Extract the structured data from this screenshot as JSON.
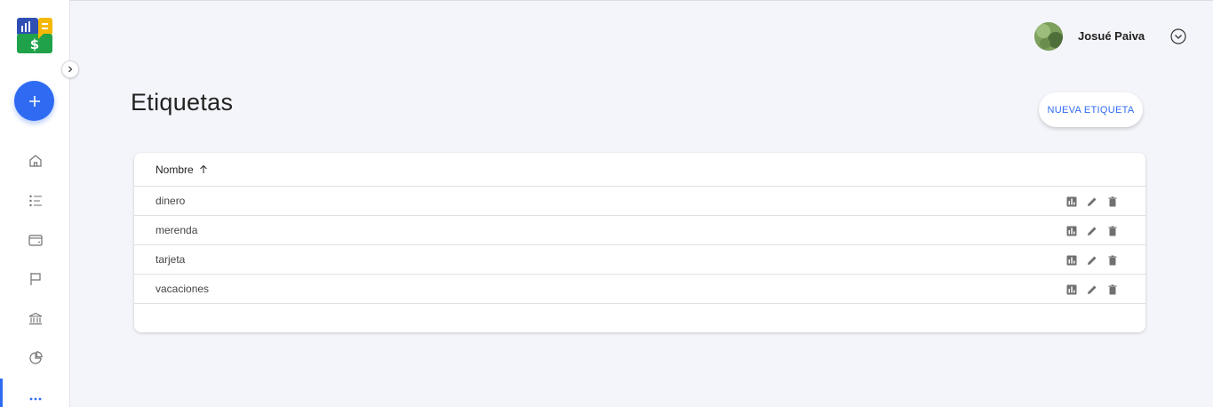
{
  "colors": {
    "accent": "#2f6bf2",
    "background": "#f4f5fa",
    "sidebar": "#ffffff",
    "icon_gray": "#707070"
  },
  "sidebar": {
    "logo": "finance-app-logo",
    "collapse_icon": "chevron-right-icon",
    "add_icon": "plus-icon",
    "items": [
      {
        "icon": "home-icon"
      },
      {
        "icon": "list-icon"
      },
      {
        "icon": "wallet-icon"
      },
      {
        "icon": "flag-icon"
      },
      {
        "icon": "bank-icon"
      },
      {
        "icon": "pie-chart-icon"
      },
      {
        "icon": "more-icon",
        "active": true
      }
    ]
  },
  "header": {
    "user_name": "Josué Paiva",
    "menu_icon": "chevron-down-circle-icon"
  },
  "main": {
    "title": "Etiquetas",
    "new_button_label": "NUEVA ETIQUETA"
  },
  "table": {
    "column_header": "Nombre",
    "sort_icon": "arrow-up-icon",
    "rows": [
      {
        "name": "dinero"
      },
      {
        "name": "merenda"
      },
      {
        "name": "tarjeta"
      },
      {
        "name": "vacaciones"
      }
    ],
    "row_action_icons": [
      "bar-chart-icon",
      "pencil-icon",
      "trash-icon"
    ]
  }
}
